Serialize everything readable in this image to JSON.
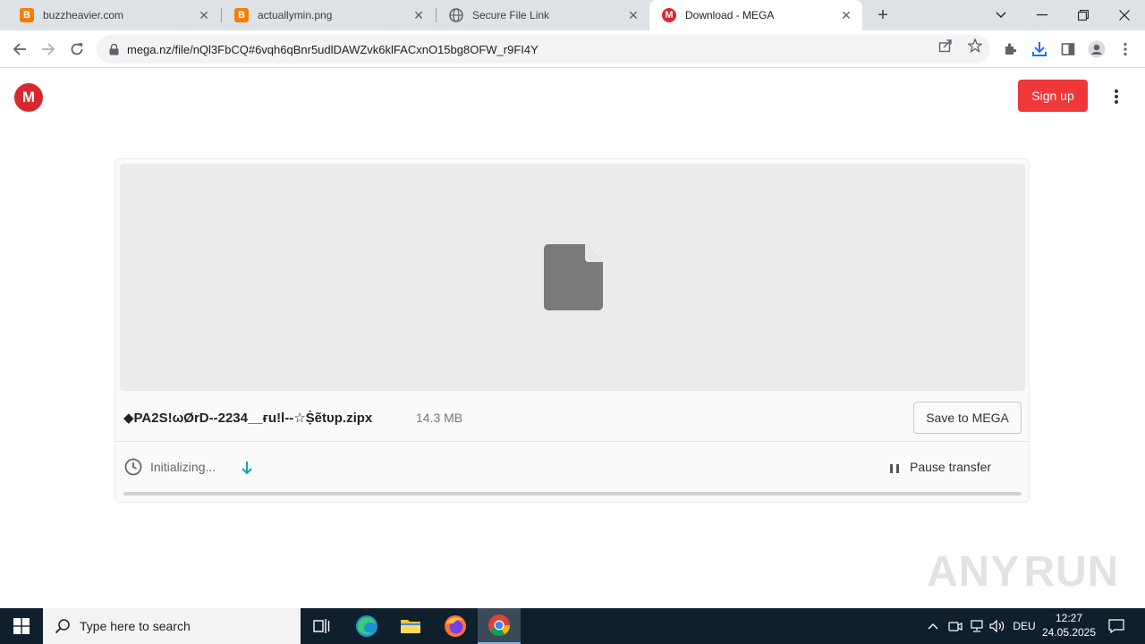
{
  "browser": {
    "tabs": [
      {
        "title": "buzzheavier.com",
        "favicon": "blogger-icon",
        "active": false
      },
      {
        "title": "actuallymin.png",
        "favicon": "blogger-icon",
        "active": false
      },
      {
        "title": "Secure File Link",
        "favicon": "globe-icon",
        "active": false
      },
      {
        "title": "Download - MEGA",
        "favicon": "mega-icon",
        "active": true
      }
    ],
    "url": "mega.nz/file/nQl3FbCQ#6vqh6qBnr5udlDAWZvk6klFACxnO15bg8OFW_r9FI4Y"
  },
  "page": {
    "logo_letter": "M",
    "signup_label": "Sign up",
    "brand_color": "#d9272e",
    "signup_color": "#f0373a"
  },
  "file": {
    "name": "◆PA2S!ωØrD--2234__ғu!l--☆Ṩẽtυp.zipx",
    "size": "14.3 MB",
    "save_label": "Save to MEGA",
    "status": "Initializing...",
    "pause_label": "Pause transfer",
    "progress": 0
  },
  "watermark": {
    "left": "ANY",
    "right": "RUN"
  },
  "taskbar": {
    "search_placeholder": "Type here to search",
    "language": "DEU",
    "time": "12:27",
    "date": "24.05.2025"
  }
}
